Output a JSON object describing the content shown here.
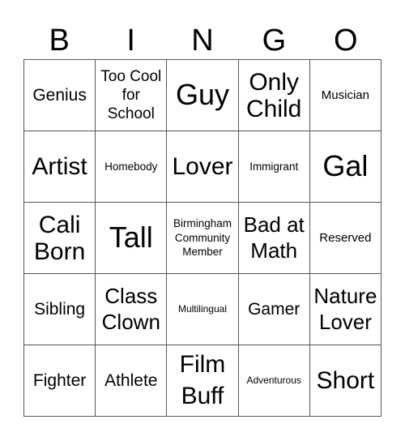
{
  "header": {
    "letters": [
      "B",
      "I",
      "N",
      "G",
      "O"
    ]
  },
  "board": {
    "cells": [
      [
        "Genius",
        "Too Cool for School",
        "Guy",
        "Only Child",
        "Musician"
      ],
      [
        "Artist",
        "Homebody",
        "Lover",
        "Immigrant",
        "Gal"
      ],
      [
        "Cali Born",
        "Tall",
        "Birmingham Community Member",
        "Bad at Math",
        "Reserved"
      ],
      [
        "Sibling",
        "Class Clown",
        "Multilingual",
        "Gamer",
        "Nature Lover"
      ],
      [
        "Fighter",
        "Athlete",
        "Film Buff",
        "Adventurous",
        "Short"
      ]
    ]
  }
}
